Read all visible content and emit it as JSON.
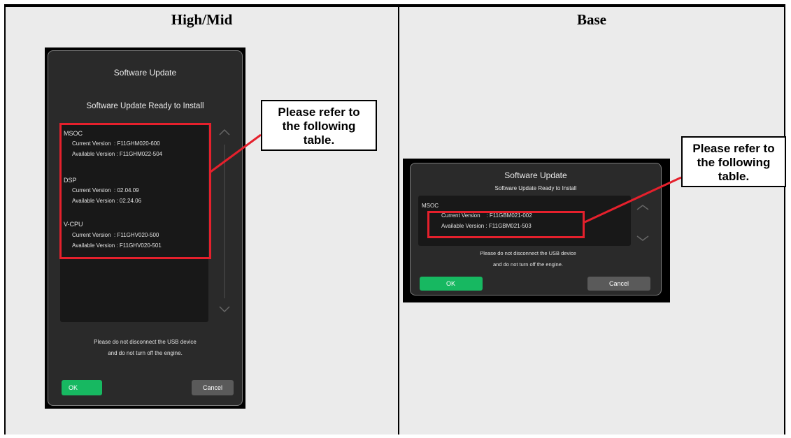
{
  "columns": {
    "left": "High/Mid",
    "right": "Base"
  },
  "callout": {
    "line1": "Please refer to",
    "line2": "the following",
    "line3": "table."
  },
  "high_mid": {
    "title": "Software Update",
    "subtitle": "Software Update Ready to Install",
    "msoc": {
      "name": "MSOC",
      "current": "Current Version  : F11GHM020-600",
      "available": "Available Version : F11GHM022-504"
    },
    "dsp": {
      "name": "DSP",
      "current": "Current Version  : 02.04.09",
      "available": "Available Version : 02.24.06"
    },
    "vcpu": {
      "name": "V-CPU",
      "current": "Current Version  : F11GHV020-500",
      "available": "Available Version : F11GHV020-501"
    },
    "warning_line1": "Please do not disconnect the USB device",
    "warning_line2": "and do not turn off the engine.",
    "ok": "OK",
    "cancel": "Cancel"
  },
  "base": {
    "title": "Software Update",
    "subtitle": "Software Update Ready to Install",
    "msoc": {
      "name": "MSOC",
      "current": "Current Version    : F11GBM021-002",
      "available": "Available Version : F11GBM021-503"
    },
    "warning_line1": "Please do not disconnect the USB device",
    "warning_line2": "and do not turn off the engine.",
    "ok": "OK",
    "cancel": "Cancel"
  },
  "colors": {
    "highlight": "#e5202c",
    "ok_button": "#17b861"
  }
}
